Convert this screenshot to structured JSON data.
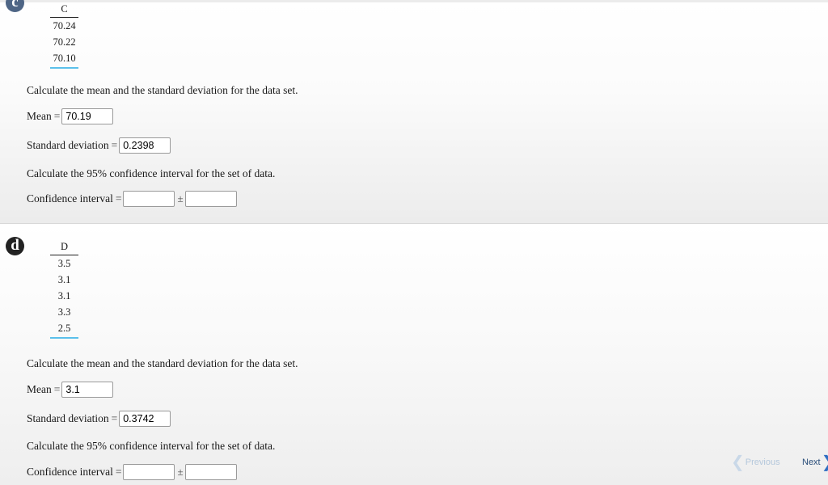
{
  "parts": [
    {
      "badge": "c",
      "column_header": "C",
      "values": [
        "70.24",
        "70.22",
        "70.10"
      ],
      "prompt_mean_sd": "Calculate the mean and the standard deviation for the data set.",
      "mean_label": "Mean",
      "mean_value": "70.19",
      "sd_label": "Standard deviation",
      "sd_value": "0.2398",
      "prompt_ci": "Calculate the 95% confidence interval for the set of data.",
      "ci_label": "Confidence interval",
      "ci_center_value": "",
      "ci_margin_value": ""
    },
    {
      "badge": "d",
      "column_header": "D",
      "values": [
        "3.5",
        "3.1",
        "3.1",
        "3.3",
        "2.5"
      ],
      "prompt_mean_sd": "Calculate the mean and the standard deviation for the data set.",
      "mean_label": "Mean",
      "mean_value": "3.1",
      "sd_label": "Standard deviation",
      "sd_value": "0.3742",
      "prompt_ci": "Calculate the 95% confidence interval for the set of data.",
      "ci_label": "Confidence interval",
      "ci_center_value": "",
      "ci_margin_value": ""
    }
  ],
  "symbols": {
    "equals": "=",
    "plus_minus": "±"
  },
  "nav": {
    "previous_label": "Previous",
    "next_label": "Next",
    "previous_icon": "chevron-left-icon",
    "next_icon": "chevron-right-icon",
    "chevron_left": "❮",
    "chevron_right": "❯"
  }
}
